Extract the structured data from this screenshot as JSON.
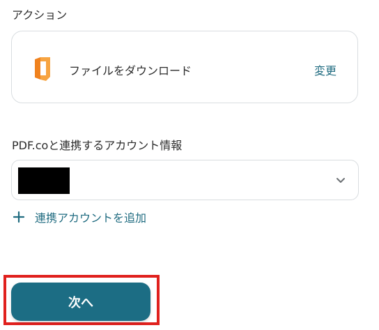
{
  "action": {
    "section_label": "アクション",
    "app_icon": "pdf-co-icon",
    "action_name": "ファイルをダウンロード",
    "change_label": "変更"
  },
  "account": {
    "section_label": "PDF.coと連携するアカウント情報",
    "selected_value_redacted": true,
    "chevron_icon": "chevron-down-icon"
  },
  "add_account": {
    "icon": "plus-icon",
    "label": "連携アカウントを追加"
  },
  "footer": {
    "next_label": "次へ"
  },
  "colors": {
    "accent": "#1f6b80",
    "button_bg": "#1c6d84",
    "highlight": "#e0201d",
    "icon_orange": "#f0821e"
  }
}
